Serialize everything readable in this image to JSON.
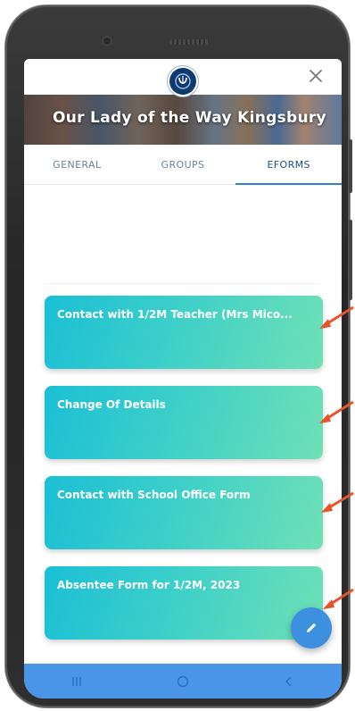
{
  "header": {
    "logo_label": "OLW",
    "close_label": "×",
    "banner_title": "Our Lady of the Way Kingsbury"
  },
  "tabs": [
    {
      "label": "GENERAL",
      "active": false
    },
    {
      "label": "GROUPS",
      "active": false
    },
    {
      "label": "EFORMS",
      "active": true
    }
  ],
  "eforms": [
    {
      "label": "Contact with 1/2M Teacher (Mrs Mico..."
    },
    {
      "label": "Change Of Details"
    },
    {
      "label": "Contact with School Office Form"
    },
    {
      "label": "Absentee Form for 1/2M, 2023"
    }
  ],
  "fab": {
    "icon": "pencil-icon"
  },
  "navbar": {
    "icons": [
      "recent-apps-icon",
      "home-icon",
      "back-icon"
    ]
  },
  "colors": {
    "card_start": "#1bbfd6",
    "card_end": "#6fe0b6",
    "tab_active": "#1e4f8a",
    "tab_indicator": "#2f80d1",
    "navbar": "#4a95e8",
    "fab": "#3d8fe0",
    "annotation_arrow": "#e8542a"
  }
}
